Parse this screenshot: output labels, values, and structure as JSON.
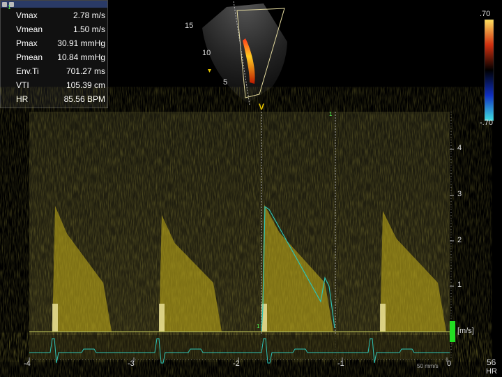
{
  "measurements": {
    "index": "1",
    "rows": [
      {
        "label": "Vmax",
        "value": "2.78 m/s"
      },
      {
        "label": "Vmean",
        "value": "1.50 m/s"
      },
      {
        "label": "Pmax",
        "value": "30.91 mmHg"
      },
      {
        "label": "Pmean",
        "value": "10.84 mmHg"
      },
      {
        "label": "Env.Ti",
        "value": "701.27 ms"
      },
      {
        "label": "VTI",
        "value": "105.39 cm"
      },
      {
        "label": "HR",
        "value": "85.56 BPM"
      }
    ]
  },
  "sector": {
    "depth_labels": [
      "15",
      "10",
      "5"
    ]
  },
  "color_scale": {
    "top": ".70",
    "bottom": "-.70"
  },
  "cursor": {
    "v_label": "V",
    "marker": "1"
  },
  "doppler": {
    "y_ticks": [
      "4",
      "3",
      "2",
      "1"
    ],
    "y_unit": "[m/s]",
    "x_ticks": [
      "-4",
      "-3",
      "-2",
      "-1",
      "0"
    ],
    "sweep_speed": "50 mm/s",
    "baseline_marker": "1"
  },
  "heart_rate": {
    "value": "56",
    "label": "HR"
  },
  "colors": {
    "spectrum": "#d8c21a",
    "trace": "#2ec4b6",
    "baseline": "#c8d060",
    "scale_bar": "#22dd22"
  }
}
